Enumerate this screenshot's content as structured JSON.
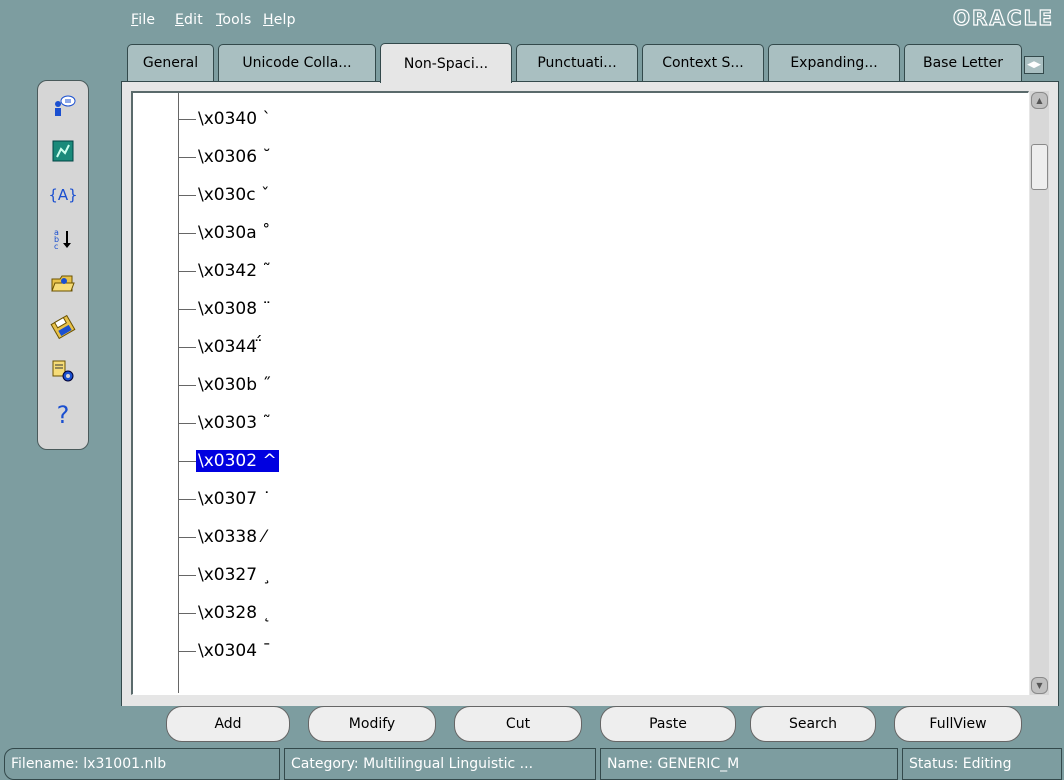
{
  "menu": [
    "File",
    "Edit",
    "Tools",
    "Help"
  ],
  "logo": "ORACLE",
  "tabs": [
    "General",
    "Unicode Colla...",
    "Non-Spaci...",
    "Punctuati...",
    "Context S...",
    "Expanding...",
    "Base Letter"
  ],
  "active_tab": "Non-Spaci...",
  "tree_nodes": [
    "\\x0340 ˋ",
    "\\x0306 ˘",
    "\\x030c ˇ",
    "\\x030a ˚",
    "\\x0342 ˜",
    "\\x0308 ¨",
    "\\x0344 ̈́",
    "\\x030b ˝",
    "\\x0303 ˜",
    "\\x0302 ^",
    "\\x0307 ˙",
    "\\x0338 ⁄",
    "\\x0327 ¸",
    "\\x0328 ˛",
    "\\x0304 ¯"
  ],
  "selected_node": "\\x0302 ^",
  "buttons": [
    "Add",
    "Modify",
    "Cut",
    "Paste",
    "Search",
    "FullView"
  ],
  "status": {
    "filename": "Filename: lx31001.nlb",
    "category": "Category: Multilingual Linguistic ...",
    "name": "Name: GENERIC_M",
    "state": "Status: Editing"
  },
  "toolbar_icons": [
    "wizard-icon",
    "map-icon",
    "variable-icon",
    "sort-icon",
    "open-folder-icon",
    "save-disk-icon",
    "properties-icon",
    "help-icon"
  ],
  "colors": {
    "background": "#7d9da0",
    "selection": "#0000e0",
    "panel": "#e6e6e6"
  }
}
